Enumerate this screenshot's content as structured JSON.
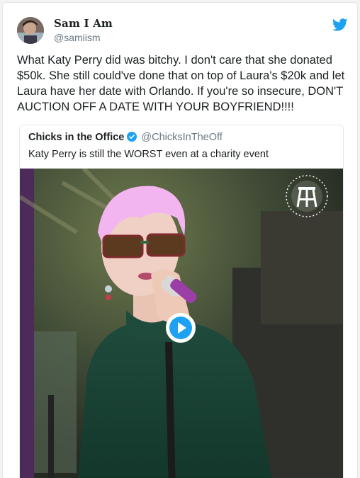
{
  "tweet": {
    "display_name": "Sam I Am",
    "handle": "@samiism",
    "text": "What Katy Perry did was bitchy. I don't care that she donated $50k. She still could've done that on top of Laura's $20k and let Laura have her date with Orlando. If you're so insecure, DON'T AUCTION OFF A DATE WITH YOUR BOYFRIEND!!!!"
  },
  "quoted_tweet": {
    "display_name": "Chicks in the Office",
    "handle": "@ChicksInTheOff",
    "text": "Katy Perry is still the WORST even at a charity event",
    "verified": true
  },
  "media": {
    "type": "video",
    "play_icon": "play-icon",
    "watermark_icon": "barstool-logo"
  },
  "colors": {
    "twitter_blue": "#1da1f2",
    "text": "#1c2022",
    "secondary": "#697882",
    "border": "#e1e8ed"
  }
}
